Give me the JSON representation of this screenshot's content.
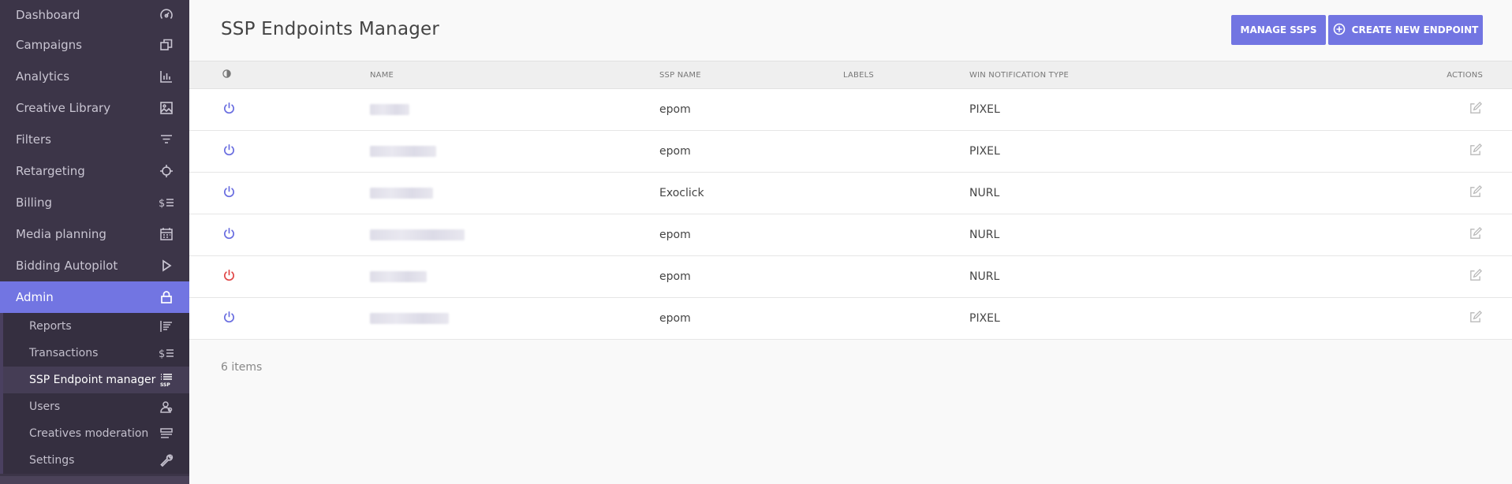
{
  "sidebar": {
    "items": [
      {
        "label": "Dashboard",
        "icon": "speedometer-icon"
      },
      {
        "label": "Campaigns",
        "icon": "copy-icon"
      },
      {
        "label": "Analytics",
        "icon": "bar-chart-icon"
      },
      {
        "label": "Creative Library",
        "icon": "image-icon"
      },
      {
        "label": "Filters",
        "icon": "filter-icon"
      },
      {
        "label": "Retargeting",
        "icon": "crosshair-icon"
      },
      {
        "label": "Billing",
        "icon": "dollar-list-icon"
      },
      {
        "label": "Media planning",
        "icon": "calendar-icon"
      },
      {
        "label": "Bidding Autopilot",
        "icon": "play-icon"
      },
      {
        "label": "Admin",
        "icon": "lock-icon"
      }
    ],
    "submenu": [
      {
        "label": "Reports",
        "icon": "report-list-icon"
      },
      {
        "label": "Transactions",
        "icon": "dollar-list-icon"
      },
      {
        "label": "SSP Endpoint manager",
        "icon": "ssp-list-icon"
      },
      {
        "label": "Users",
        "icon": "users-icon"
      },
      {
        "label": "Creatives moderation",
        "icon": "moderation-icon"
      },
      {
        "label": "Settings",
        "icon": "wrench-icon"
      }
    ],
    "ssp_badge": "SSP"
  },
  "header": {
    "title": "SSP Endpoints Manager",
    "manage_label": "MANAGE SSPS",
    "create_label": "CREATE NEW ENDPOINT"
  },
  "table": {
    "columns": [
      "NAME",
      "SSP NAME",
      "LABELS",
      "WIN NOTIFICATION TYPE",
      "ACTIONS"
    ],
    "rows": [
      {
        "status": "active",
        "ssp": "epom",
        "labels": "",
        "win": "PIXEL"
      },
      {
        "status": "active",
        "ssp": "epom",
        "labels": "",
        "win": "PIXEL"
      },
      {
        "status": "active",
        "ssp": "Exoclick",
        "labels": "",
        "win": "NURL"
      },
      {
        "status": "active",
        "ssp": "epom",
        "labels": "",
        "win": "NURL"
      },
      {
        "status": "inactive",
        "ssp": "epom",
        "labels": "",
        "win": "NURL"
      },
      {
        "status": "active",
        "ssp": "epom",
        "labels": "",
        "win": "PIXEL"
      }
    ]
  },
  "footer": {
    "count_label": "6 items"
  },
  "colors": {
    "accent": "#7275e2",
    "power_active": "#6a6ee0",
    "power_inactive": "#e04848",
    "sidebar_bg": "#3c3548"
  }
}
